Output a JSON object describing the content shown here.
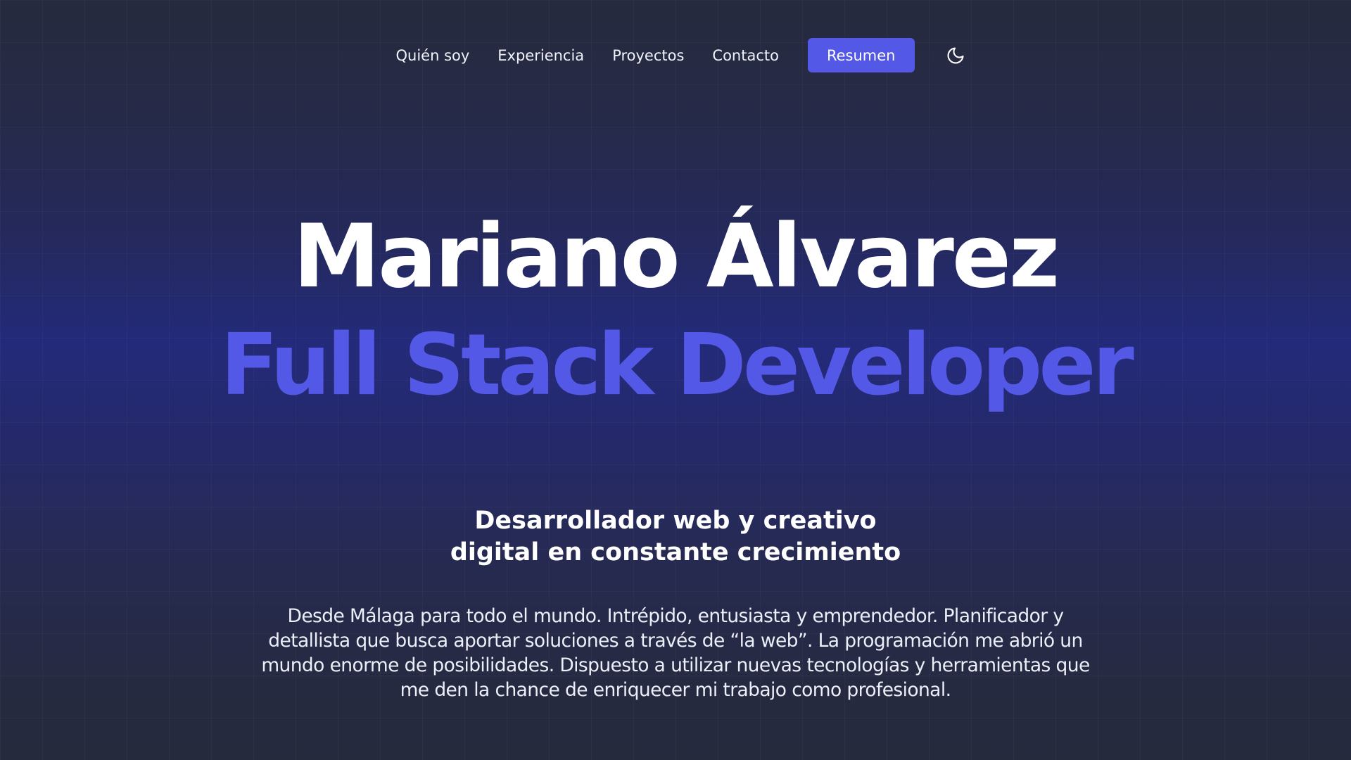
{
  "nav": {
    "links": [
      {
        "label": "Quién soy"
      },
      {
        "label": "Experiencia"
      },
      {
        "label": "Proyectos"
      },
      {
        "label": "Contacto"
      }
    ],
    "resume_label": "Resumen",
    "theme_icon": "moon-icon"
  },
  "hero": {
    "name": "Mariano Álvarez",
    "role": "Full Stack Developer"
  },
  "tagline": {
    "line1": "Desarrollador web y creativo",
    "line2": "digital en constante crecimiento"
  },
  "about": {
    "text": "Desde Málaga para todo el mundo. Intrépido, entusiasta y emprendedor. Planificador y detallista que busca aportar soluciones a través de “la web”. La programación me abrió un mundo enorme de posibilidades. Dispuesto a utilizar nuevas tecnologías y herramientas que me den la chance de enriquecer mi trabajo como profesional."
  },
  "colors": {
    "accent": "#5458e6",
    "background": "#262a3d",
    "glow": "#232a7a",
    "text": "#ffffff"
  }
}
